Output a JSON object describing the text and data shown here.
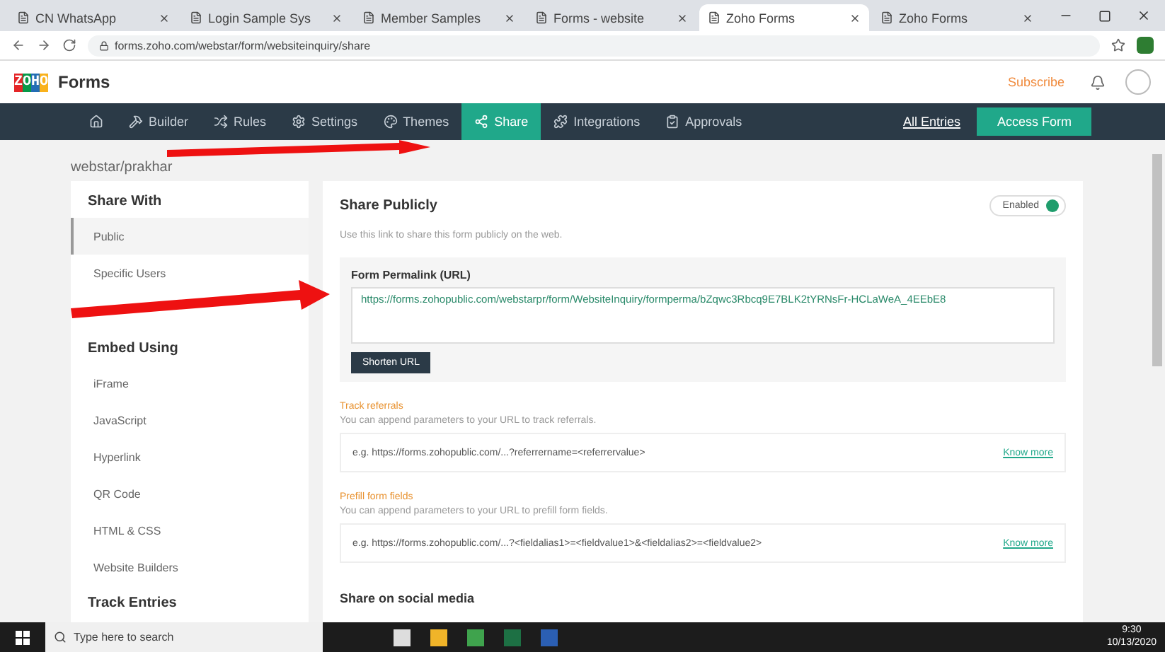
{
  "browser": {
    "tabs": [
      {
        "label": "CN WhatsApp",
        "selected": false
      },
      {
        "label": "Login Sample Sys",
        "selected": false
      },
      {
        "label": "Member Samples",
        "selected": false
      },
      {
        "label": "Forms - website",
        "selected": false
      },
      {
        "label": "Zoho Forms",
        "selected": true
      },
      {
        "label": "Zoho Forms",
        "selected": false
      }
    ],
    "url": "forms.zoho.com/webstar/form/websiteinquiry/share"
  },
  "app": {
    "logo": "ZOHO",
    "name": "Forms",
    "subscribe": "Subscribe"
  },
  "nav": {
    "items": [
      {
        "kind": "home",
        "selected": false
      },
      {
        "kind": "builder",
        "label": "Builder",
        "selected": false
      },
      {
        "kind": "rules",
        "label": "Rules",
        "selected": false
      },
      {
        "kind": "settings",
        "label": "Settings",
        "selected": false
      },
      {
        "kind": "themes",
        "label": "Themes",
        "selected": false
      },
      {
        "kind": "share",
        "label": "Share",
        "selected": true
      },
      {
        "kind": "integrations",
        "label": "Integrations",
        "selected": false
      },
      {
        "kind": "approvals",
        "label": "Approvals",
        "selected": false
      }
    ],
    "all_entries": "All Entries",
    "access_form": "Access Form"
  },
  "breadcrumb": "webstar/prakhar",
  "sidebar": {
    "sections": [
      {
        "title": "Share With",
        "items": [
          {
            "label": "Public",
            "selected": true
          },
          {
            "label": "Specific Users",
            "selected": false
          }
        ]
      },
      {
        "title": "Embed Using",
        "items": [
          {
            "label": "iFrame",
            "selected": false
          },
          {
            "label": "JavaScript",
            "selected": false
          },
          {
            "label": "Hyperlink",
            "selected": false
          },
          {
            "label": "QR Code",
            "selected": false
          },
          {
            "label": "HTML & CSS",
            "selected": false
          },
          {
            "label": "Website Builders",
            "selected": false
          }
        ]
      },
      {
        "title": "Track Entries"
      }
    ]
  },
  "share_publicly": {
    "title": "Share Publicly",
    "description": "Use this link to share this form publicly on the web.",
    "toggle": {
      "label": "Enabled",
      "on": true
    },
    "permalink": {
      "label": "Form Permalink (URL)",
      "value": "https://forms.zohopublic.com/webstarpr/form/WebsiteInquiry/formperma/bZqwc3Rbcq9E7BLK2tYRNsFr-HCLaWeA_4EEbE8",
      "button": "Shorten URL"
    },
    "sections": [
      {
        "title": "Track referrals",
        "description": "You can append parameters to your URL to track referrals.",
        "example": "e.g. https://forms.zohopublic.com/...?referrername=<referrervalue>",
        "link": "Know more"
      },
      {
        "title": "Prefill form fields",
        "description": "You can append parameters to your URL to prefill form fields.",
        "example": "e.g. https://forms.zohopublic.com/...?<fieldalias1>=<fieldvalue1>&<fieldalias2>=<fieldvalue2>",
        "link": "Know more"
      }
    ],
    "next_title": "Share on social media"
  },
  "taskbar": {
    "search_placeholder": "Type here to search",
    "time": "9:30",
    "date": "10/13/2020"
  }
}
